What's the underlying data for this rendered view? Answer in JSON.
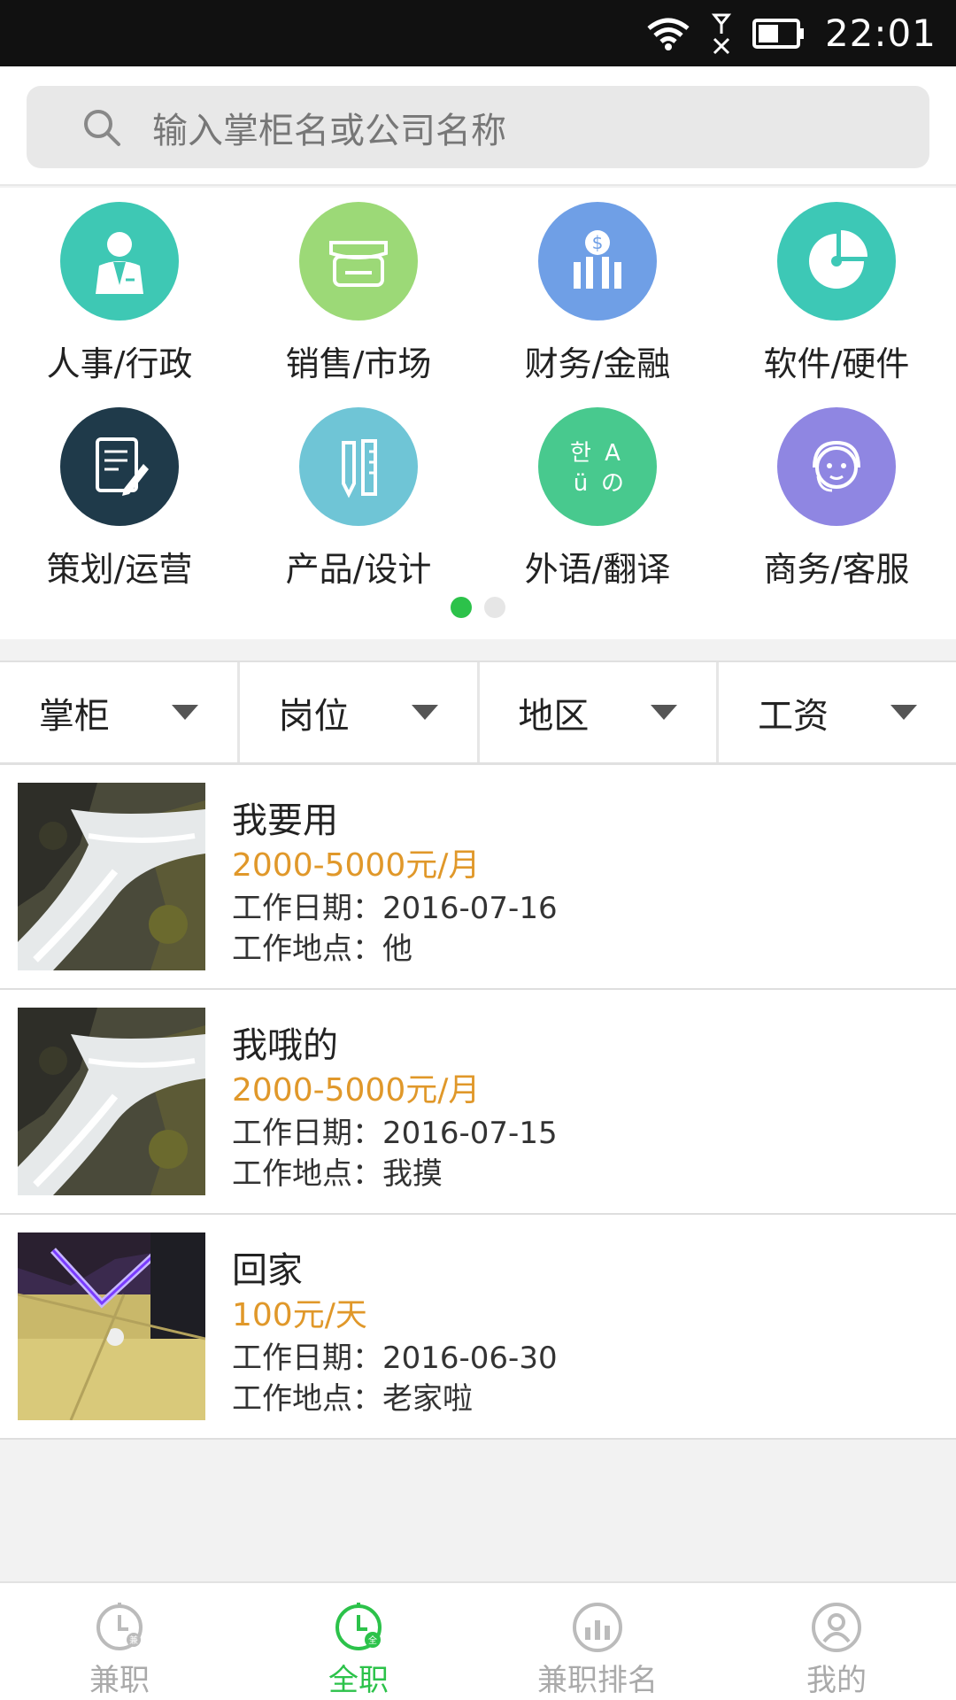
{
  "status_bar": {
    "time": "22:01"
  },
  "search": {
    "placeholder": "输入掌柜名或公司名称"
  },
  "categories": [
    {
      "label": "人事/行政",
      "color": "#3ec8b4",
      "icon": "businessman-icon"
    },
    {
      "label": "销售/市场",
      "color": "#9cd977",
      "icon": "store-icon"
    },
    {
      "label": "财务/金融",
      "color": "#6f9fe6",
      "icon": "finance-chart-icon"
    },
    {
      "label": "软件/硬件",
      "color": "#3dc8b6",
      "icon": "pie-chart-icon"
    },
    {
      "label": "策划/运营",
      "color": "#1f3a4a",
      "icon": "document-edit-icon"
    },
    {
      "label": "产品/设计",
      "color": "#6fc5d6",
      "icon": "pencil-ruler-icon"
    },
    {
      "label": "外语/翻译",
      "color": "#48c98e",
      "icon": "language-icon"
    },
    {
      "label": "商务/客服",
      "color": "#8f86e2",
      "icon": "customer-service-icon"
    }
  ],
  "language_glyphs": {
    "a": "한",
    "b": "A",
    "c": "ü",
    "d": "の"
  },
  "filters": [
    {
      "label": "掌柜"
    },
    {
      "label": "岗位"
    },
    {
      "label": "地区"
    },
    {
      "label": "工资"
    }
  ],
  "jobs": [
    {
      "title": "我要用",
      "salary": "2000-5000元/月",
      "date_label": "工作日期：",
      "date": "2016-07-16",
      "place_label": "工作地点：",
      "place": "他",
      "thumb": "waterfall"
    },
    {
      "title": "我哦的",
      "salary": "2000-5000元/月",
      "date_label": "工作日期：",
      "date": "2016-07-15",
      "place_label": "工作地点：",
      "place": "我摸",
      "thumb": "waterfall"
    },
    {
      "title": "回家",
      "salary": "100元/天",
      "date_label": "工作日期：",
      "date": "2016-06-30",
      "place_label": "工作地点：",
      "place": "老家啦",
      "thumb": "floor"
    }
  ],
  "tabs": [
    {
      "label": "兼职",
      "badge": "兼",
      "active": false,
      "icon": "clock-icon"
    },
    {
      "label": "全职",
      "badge": "全",
      "active": true,
      "icon": "clock-icon"
    },
    {
      "label": "兼职排名",
      "active": false,
      "icon": "ranking-icon"
    },
    {
      "label": "我的",
      "active": false,
      "icon": "user-icon"
    }
  ],
  "colors": {
    "accent": "#2cc24a",
    "salary": "#e0982a"
  }
}
